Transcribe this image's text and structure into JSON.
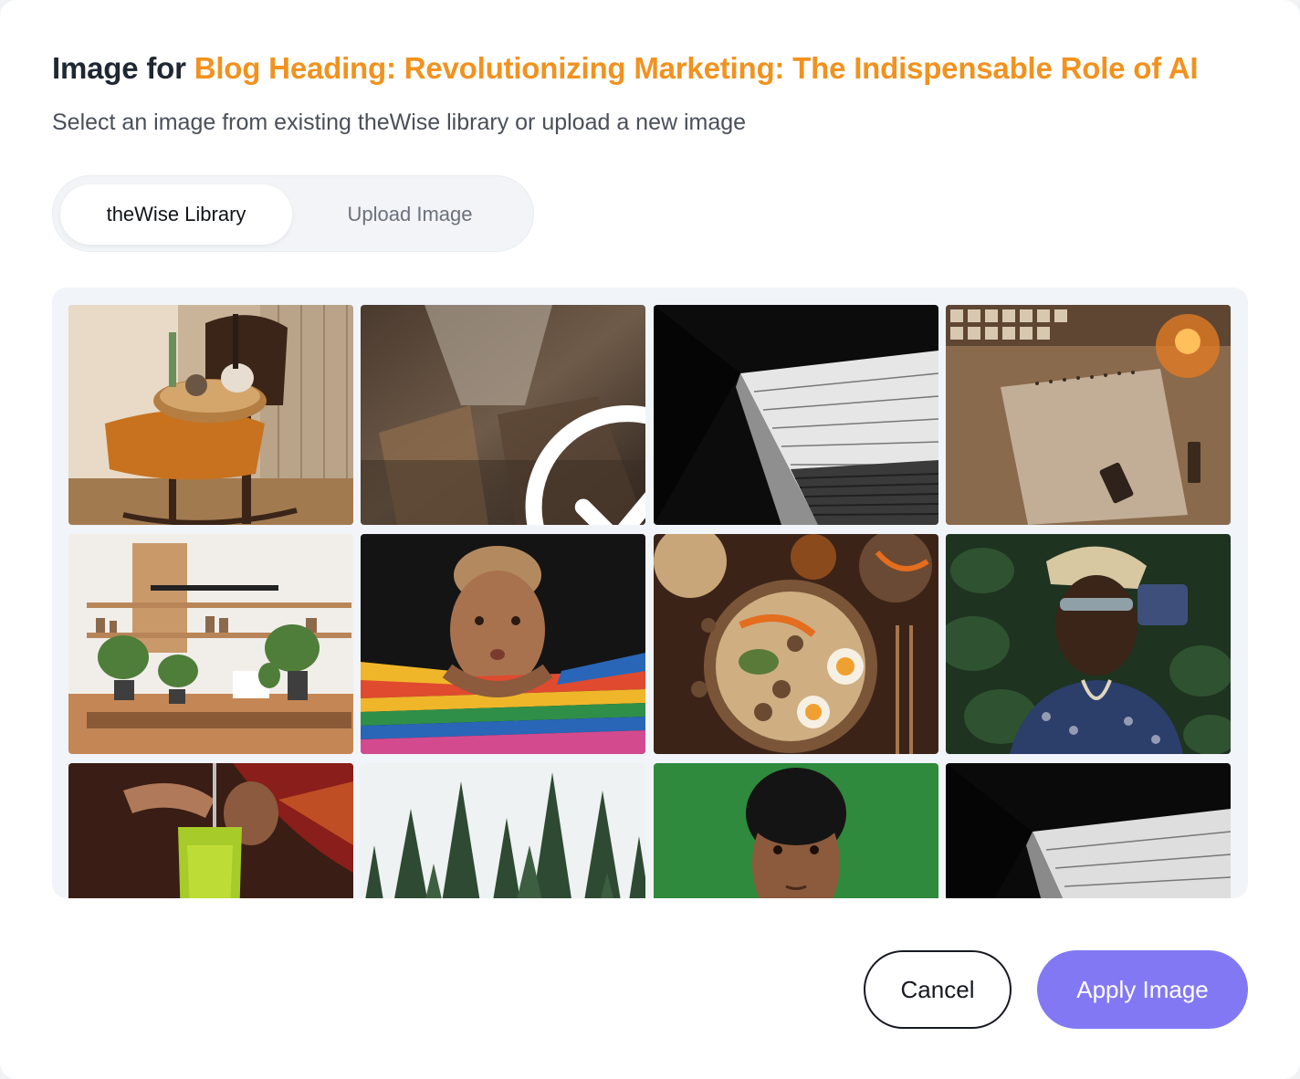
{
  "dialog": {
    "title_prefix": "Image for ",
    "title_accent": "Blog Heading: Revolutionizing Marketing: The Indispensable Role of AI",
    "subtitle": "Select an image from existing theWise library or upload a new image"
  },
  "tabs": [
    {
      "label": "theWise Library",
      "active": true
    },
    {
      "label": "Upload Image",
      "active": false
    }
  ],
  "gallery": {
    "selected_index": 1,
    "images": [
      {
        "name": "chair-with-tray-image"
      },
      {
        "name": "blurred-interior-image"
      },
      {
        "name": "building-stairs-bw-image"
      },
      {
        "name": "autumn-notebook-image"
      },
      {
        "name": "kitchen-shelves-plants-image"
      },
      {
        "name": "woman-striped-sweater-image"
      },
      {
        "name": "ramen-bowl-image"
      },
      {
        "name": "man-bucket-hat-image"
      },
      {
        "name": "green-drink-image"
      },
      {
        "name": "pine-forest-image"
      },
      {
        "name": "man-green-background-image"
      },
      {
        "name": "building-bw-image"
      }
    ]
  },
  "footer": {
    "cancel_label": "Cancel",
    "apply_label": "Apply Image"
  },
  "colors": {
    "accent": "#f1921f",
    "primary": "#8378f4"
  }
}
